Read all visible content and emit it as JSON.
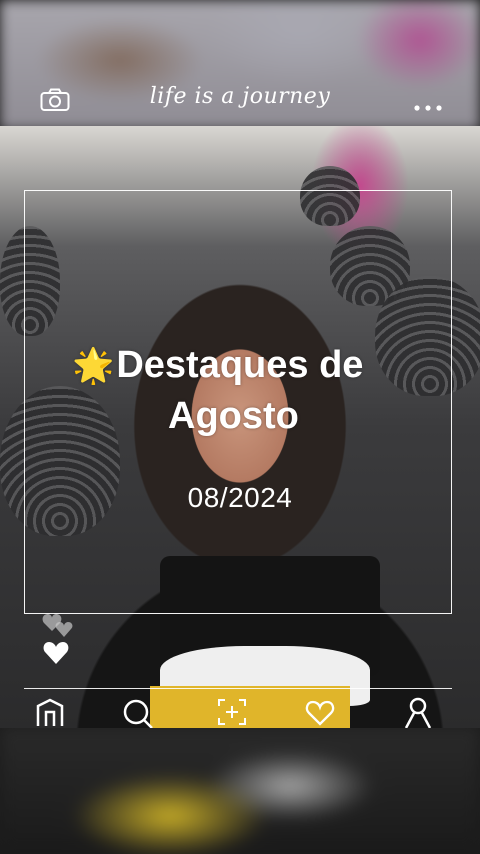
{
  "app": {
    "title": "life is a journey"
  },
  "overlay": {
    "star_emoji": "🌟",
    "headline_line1": "Destaques de",
    "headline_line2": "Agosto",
    "date": "08/2024"
  },
  "icons": {
    "camera": "camera-icon",
    "more": "more-icon",
    "heart_outline": "heart-outline-icon",
    "heart_filled": "heart-filled-icon",
    "home": "home-icon",
    "search": "search-icon",
    "add": "add-icon",
    "likes": "heart-icon",
    "profile": "profile-icon"
  },
  "colors": {
    "overlay_text": "#ffffff",
    "heart_outline": "#bdbdbd"
  }
}
